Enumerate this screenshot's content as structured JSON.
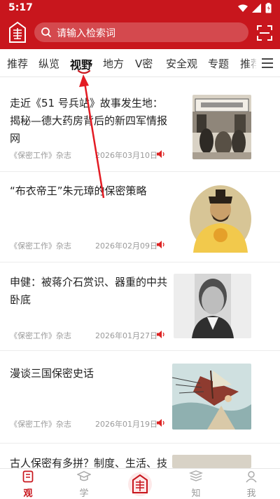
{
  "status_bar": {
    "time": "5:17"
  },
  "header": {
    "logo_char": "密",
    "search_placeholder": "请输入检索词"
  },
  "tabs": [
    {
      "label": "推荐"
    },
    {
      "label": "纵览"
    },
    {
      "label": "视野",
      "active": true
    },
    {
      "label": "地方"
    },
    {
      "label": "V密"
    },
    {
      "label": "安全观"
    },
    {
      "label": "专题"
    },
    {
      "label": "推荐"
    }
  ],
  "articles": [
    {
      "title": "走近《51 号兵站》故事发生地：揭秘—德大药房背后的新四军情报网",
      "source": "《保密工作》杂志",
      "date": "2026年03月10日"
    },
    {
      "title": "“布衣帝王”朱元璋的保密策略",
      "source": "《保密工作》杂志",
      "date": "2026年02月09日"
    },
    {
      "title": "申健：被蒋介石赏识、器重的中共卧底",
      "source": "《保密工作》杂志",
      "date": "2026年01月27日"
    },
    {
      "title": "漫谈三国保密史话",
      "source": "《保密工作》杂志",
      "date": "2026年01月19日"
    },
    {
      "title": "古人保密有多拼？制度、生活、技艺",
      "source": "",
      "date": ""
    }
  ],
  "bottom_nav": [
    {
      "label": "观",
      "active": true
    },
    {
      "label": "学"
    },
    {
      "label": "密"
    },
    {
      "label": "知"
    },
    {
      "label": "我"
    }
  ],
  "colors": {
    "brand_red": "#c8161d",
    "annotation_red": "#e31b23"
  }
}
